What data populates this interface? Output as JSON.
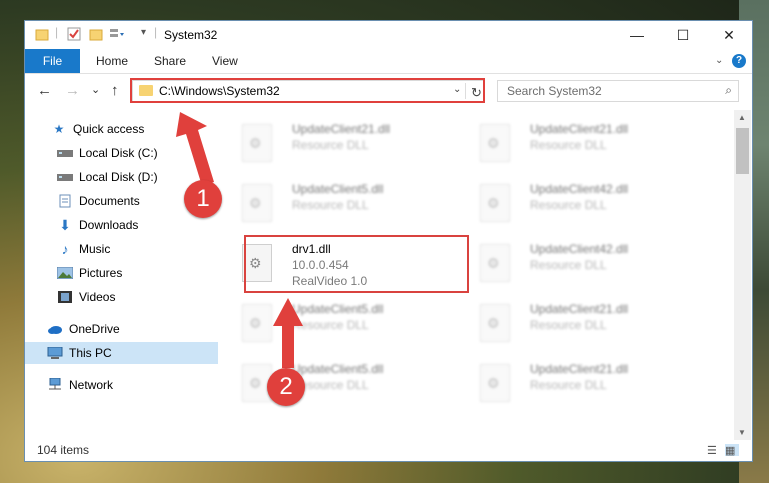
{
  "window": {
    "title": "System32",
    "buttons": {
      "minimize": "—",
      "maximize": "☐",
      "close": "✕"
    }
  },
  "ribbon": {
    "file": "File",
    "tabs": [
      "Home",
      "Share",
      "View"
    ],
    "help": "?"
  },
  "navigation": {
    "back": "←",
    "forward": "→",
    "recent": "⌄",
    "up": "↑",
    "address": "C:\\Windows\\System32",
    "refresh": "↻",
    "search_placeholder": "Search System32"
  },
  "sidebar": {
    "items": [
      {
        "label": "Quick access",
        "icon": "star-icon"
      },
      {
        "label": "Local Disk (C:)",
        "icon": "drive-icon",
        "pinned": true
      },
      {
        "label": "Local Disk (D:)",
        "icon": "drive-icon",
        "pinned": true
      },
      {
        "label": "Documents",
        "icon": "documents-icon",
        "pinned": true
      },
      {
        "label": "Downloads",
        "icon": "downloads-icon",
        "pinned": true
      },
      {
        "label": "Music",
        "icon": "music-icon",
        "pinned": true
      },
      {
        "label": "Pictures",
        "icon": "pictures-icon",
        "pinned": true
      },
      {
        "label": "Videos",
        "icon": "videos-icon",
        "pinned": true
      },
      {
        "label": "OneDrive",
        "icon": "cloud-icon"
      },
      {
        "label": "This PC",
        "icon": "computer-icon",
        "selected": true
      },
      {
        "label": "Network",
        "icon": "network-icon"
      }
    ]
  },
  "files": {
    "left_column": [
      {
        "name": "UpdateClient21.dll",
        "desc": "Resource DLL",
        "blurred": true
      },
      {
        "name": "UpdateClient5.dll",
        "desc": "Resource DLL",
        "blurred": true
      },
      {
        "name": "drv1.dll",
        "desc": "10.0.0.454",
        "desc2": "RealVideo 1.0",
        "blurred": false
      },
      {
        "name": "UpdateClient5.dll",
        "desc": "Resource DLL",
        "blurred": true
      },
      {
        "name": "UpdateClient5.dll",
        "desc": "Resource DLL",
        "blurred": true
      }
    ],
    "right_column": [
      {
        "name": "UpdateClient21.dll",
        "desc": "Resource DLL"
      },
      {
        "name": "UpdateClient42.dll",
        "desc": "Resource DLL"
      },
      {
        "name": "UpdateClient42.dll",
        "desc": "Resource DLL"
      },
      {
        "name": "UpdateClient21.dll",
        "desc": "Resource DLL"
      },
      {
        "name": "UpdateClient21.dll",
        "desc": "Resource DLL"
      }
    ]
  },
  "status": {
    "items_count": "104 items"
  },
  "annotations": {
    "step1": "1",
    "step2": "2",
    "color": "#e0403c"
  }
}
